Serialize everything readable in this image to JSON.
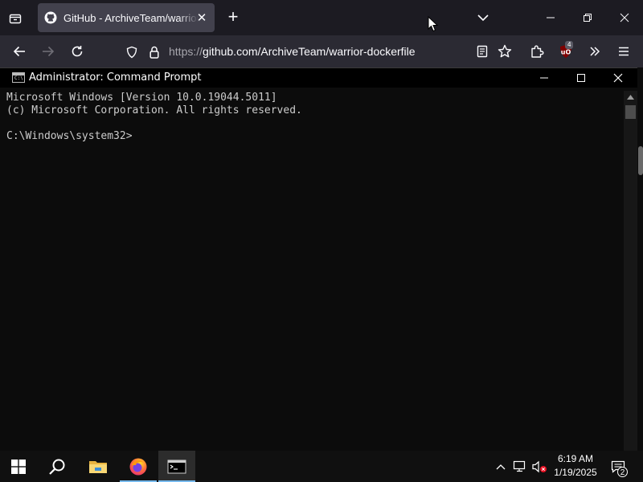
{
  "browser": {
    "tab": {
      "title": "GitHub - ArchiveTeam/warrior-dockerfile",
      "close_glyph": "✕"
    },
    "new_tab_glyph": "+",
    "url": {
      "scheme": "https://",
      "rest": "github.com/ArchiveTeam/warrior-dockerfile"
    },
    "extension_badge": "4"
  },
  "cmd": {
    "title": "Administrator: Command Prompt",
    "icon_text": "C:\\",
    "lines": [
      "Microsoft Windows [Version 10.0.19044.5011]",
      "(c) Microsoft Corporation. All rights reserved.",
      "",
      "C:\\Windows\\system32>"
    ]
  },
  "taskbar": {
    "clock_time": "6:19 AM",
    "clock_date": "1/19/2025",
    "notification_count": "2"
  },
  "icons": [
    "tab-list-icon",
    "github-icon",
    "close-icon",
    "plus-icon",
    "chevron-down-icon",
    "minimize-icon",
    "maximize-icon",
    "back-icon",
    "forward-icon",
    "reload-icon",
    "shield-icon",
    "lock-icon",
    "reader-view-icon",
    "star-icon",
    "extensions-icon",
    "ublock-icon",
    "overflow-icon",
    "menu-icon",
    "windows-start-icon",
    "search-icon",
    "file-explorer-icon",
    "firefox-icon",
    "terminal-icon",
    "chevron-up-icon",
    "network-icon",
    "volume-muted-icon",
    "action-center-icon"
  ],
  "colors": {
    "accent": "#76b9ed",
    "ublock": "#800000",
    "firefox_orange": "#ff7139"
  }
}
